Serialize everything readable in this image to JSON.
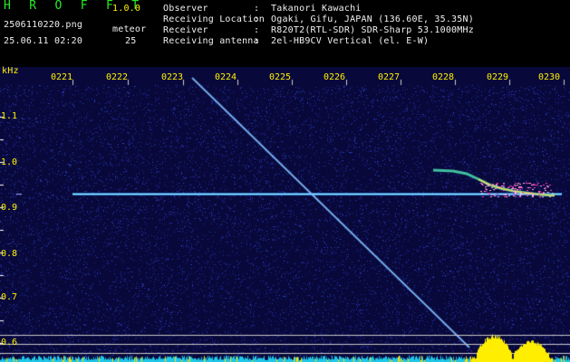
{
  "header": {
    "app_name": "H R O F F T",
    "version": "1.0.0",
    "file_name": "2506110220.png",
    "datetime": "25.06.11 02:20",
    "meteor_label": "meteor",
    "meteor_count": "25",
    "fields": [
      {
        "label": "Observer",
        "value": "Takanori Kawachi"
      },
      {
        "label": "Receiving Location",
        "value": "Ogaki, Gifu, JAPAN (136.60E, 35.35N)"
      },
      {
        "label": "Receiver",
        "value": "R820T2(RTL-SDR) SDR-Sharp 53.1000MHz"
      },
      {
        "label": "Receiving antenna",
        "value": "2el-HB9CV Vertical (el. E-W)"
      }
    ]
  },
  "spectrogram": {
    "y_unit": "kHz",
    "y_ticks": [
      "1.1",
      "1.0",
      "0.9",
      "0.8",
      "0.7",
      "0.6"
    ],
    "x_ticks": [
      "0221",
      "0222",
      "0223",
      "0224",
      "0225",
      "0226",
      "0227",
      "0228",
      "0229",
      "0230"
    ],
    "carrier_khz": 0.93,
    "colors": {
      "background": "#08083a",
      "noise": "#1e2aa6",
      "carrier": "#9ff0ff",
      "meteor": "#ff40c0",
      "signal_level": "#ffee00",
      "tick_text": "#fff200"
    }
  }
}
